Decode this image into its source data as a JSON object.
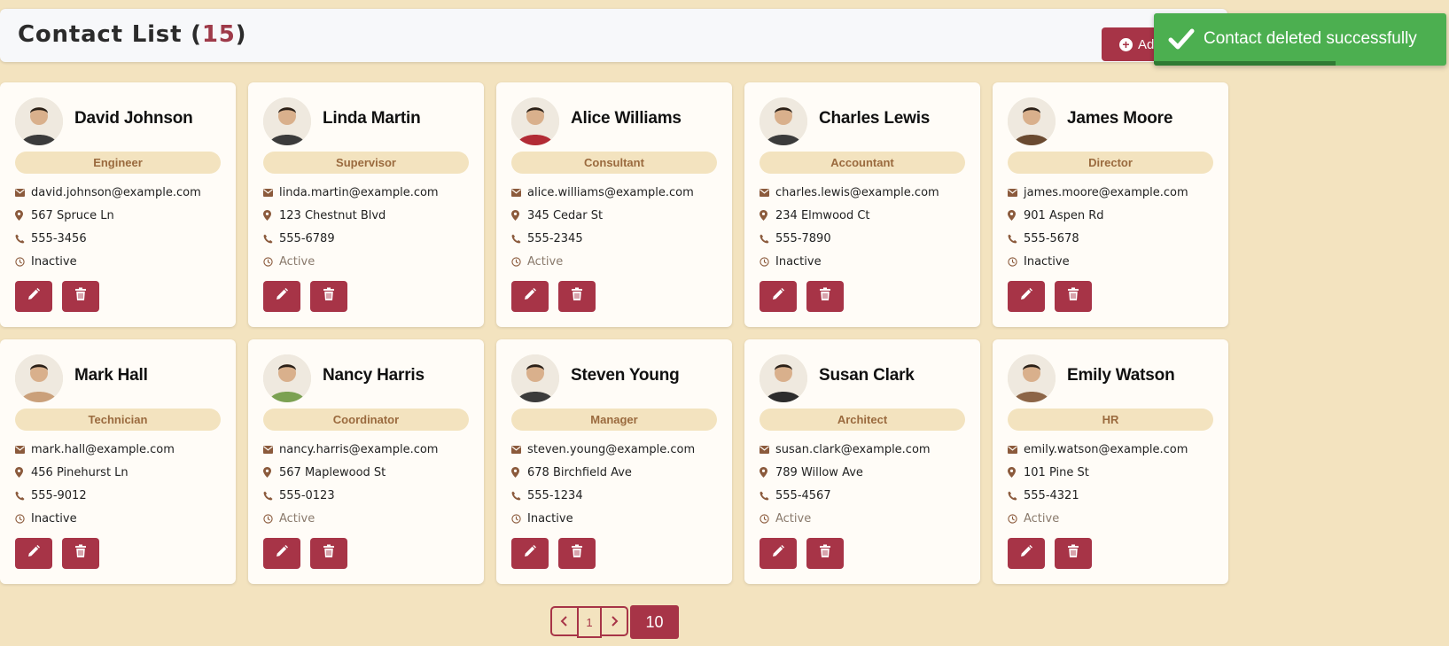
{
  "header": {
    "title": "Contact List (",
    "count": "15",
    "title_end": ")",
    "add_label": "Ad"
  },
  "toast": {
    "message": "Contact deleted successfully",
    "progress": 0.62,
    "color": "#4caf50"
  },
  "contacts": [
    {
      "name": "David Johnson",
      "role": "Engineer",
      "email": "david.johnson@example.com",
      "address": "567 Spruce Ln",
      "phone": "555-3456",
      "status": "Inactive"
    },
    {
      "name": "Linda Martin",
      "role": "Supervisor",
      "email": "linda.martin@example.com",
      "address": "123 Chestnut Blvd",
      "phone": "555-6789",
      "status": "Active"
    },
    {
      "name": "Alice Williams",
      "role": "Consultant",
      "email": "alice.williams@example.com",
      "address": "345 Cedar St",
      "phone": "555-2345",
      "status": "Active"
    },
    {
      "name": "Charles Lewis",
      "role": "Accountant",
      "email": "charles.lewis@example.com",
      "address": "234 Elmwood Ct",
      "phone": "555-7890",
      "status": "Inactive"
    },
    {
      "name": "James Moore",
      "role": "Director",
      "email": "james.moore@example.com",
      "address": "901 Aspen Rd",
      "phone": "555-5678",
      "status": "Inactive"
    },
    {
      "name": "Mark Hall",
      "role": "Technician",
      "email": "mark.hall@example.com",
      "address": "456 Pinehurst Ln",
      "phone": "555-9012",
      "status": "Inactive"
    },
    {
      "name": "Nancy Harris",
      "role": "Coordinator",
      "email": "nancy.harris@example.com",
      "address": "567 Maplewood St",
      "phone": "555-0123",
      "status": "Active"
    },
    {
      "name": "Steven Young",
      "role": "Manager",
      "email": "steven.young@example.com",
      "address": "678 Birchfield Ave",
      "phone": "555-1234",
      "status": "Inactive"
    },
    {
      "name": "Susan Clark",
      "role": "Architect",
      "email": "susan.clark@example.com",
      "address": "789 Willow Ave",
      "phone": "555-4567",
      "status": "Active"
    },
    {
      "name": "Emily Watson",
      "role": "HR",
      "email": "emily.watson@example.com",
      "address": "101 Pine St",
      "phone": "555-4321",
      "status": "Active"
    }
  ],
  "pagination": {
    "current_page": "1",
    "page_size": "10"
  },
  "colors": {
    "accent": "#a73447",
    "background": "#f3e3bf",
    "card": "#fffcf7",
    "role_badge": "#f3e3bf"
  }
}
